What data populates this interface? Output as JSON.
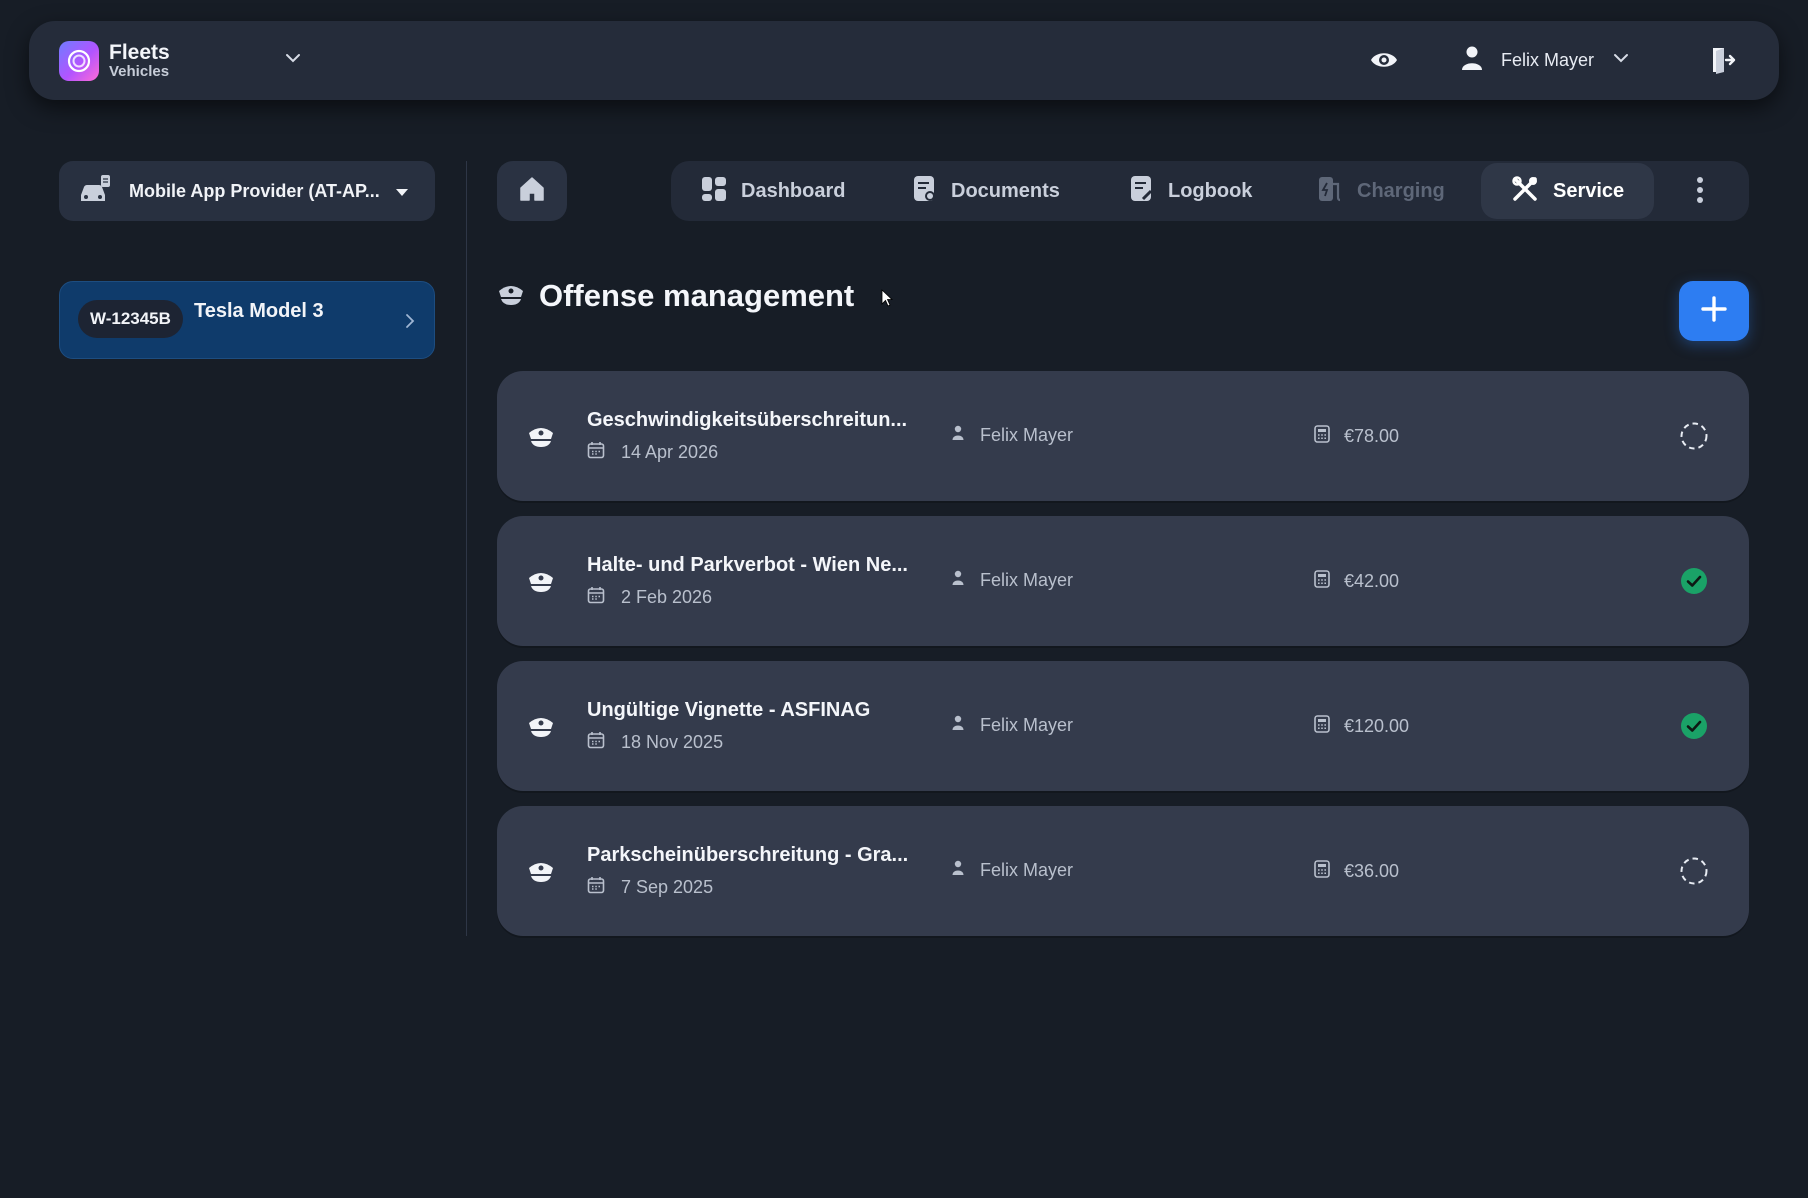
{
  "topbar": {
    "brand_title": "Fleets",
    "brand_subtitle": "Vehicles",
    "user_name": "Felix Mayer"
  },
  "sidebar": {
    "provider_label": "Mobile App Provider (AT-AP...",
    "vehicle": {
      "plate": "W-12345B",
      "name": "Tesla Model 3"
    }
  },
  "nav": {
    "tabs": [
      {
        "label": "Dashboard",
        "icon": "dashboard-icon",
        "state": "normal"
      },
      {
        "label": "Documents",
        "icon": "document-icon",
        "state": "normal"
      },
      {
        "label": "Logbook",
        "icon": "logbook-icon",
        "state": "normal"
      },
      {
        "label": "Charging",
        "icon": "charging-icon",
        "state": "disabled"
      },
      {
        "label": "Service",
        "icon": "tools-icon",
        "state": "active"
      }
    ]
  },
  "page": {
    "title": "Offense management"
  },
  "offenses": [
    {
      "title": "Geschwindigkeitsüberschreitun...",
      "date": "14 Apr 2026",
      "person": "Felix Mayer",
      "amount": "€78.00",
      "status": "pending"
    },
    {
      "title": "Halte- und Parkverbot - Wien Ne...",
      "date": "2 Feb 2026",
      "person": "Felix Mayer",
      "amount": "€42.00",
      "status": "paid"
    },
    {
      "title": "Ungültige Vignette - ASFINAG",
      "date": "18 Nov 2025",
      "person": "Felix Mayer",
      "amount": "€120.00",
      "status": "paid"
    },
    {
      "title": "Parkscheinüberschreitung - Gra...",
      "date": "7 Sep 2025",
      "person": "Felix Mayer",
      "amount": "€36.00",
      "status": "pending"
    }
  ],
  "colors": {
    "background": "#171d26",
    "accent": "#2d7df2",
    "success": "#1aa267",
    "vehicle_card": "#0f3b6b"
  }
}
